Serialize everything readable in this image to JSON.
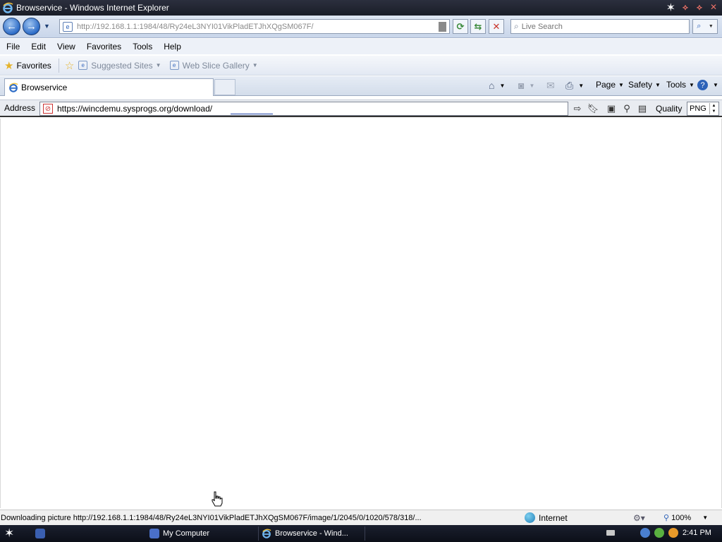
{
  "window": {
    "title": "Browservice - Windows Internet Explorer"
  },
  "navbar": {
    "url": "http://192.168.1.1:1984/48/Ry24eL3NYI01VikPladETJhXQgSM067F/",
    "search_placeholder": "Live Search"
  },
  "menu": [
    "File",
    "Edit",
    "View",
    "Favorites",
    "Tools",
    "Help"
  ],
  "favorites_bar": {
    "favorites_label": "Favorites",
    "links": [
      {
        "label": "Suggested Sites"
      },
      {
        "label": "Web Slice Gallery"
      }
    ]
  },
  "tabs": {
    "active": "Browservice"
  },
  "command_bar": {
    "page": "Page",
    "safety": "Safety",
    "tools": "Tools"
  },
  "address_bar": {
    "label": "Address",
    "value": "https://wincdemu.sysprogs.org/download/",
    "quality_label": "Quality",
    "quality_value": "PNG"
  },
  "status": {
    "text": "Downloading picture http://192.168.1.1:1984/48/Ry24eL3NYI01VikPladETJhXQgSM067F/image/1/2045/0/1020/578/318/...",
    "zone": "Internet",
    "zoom": "100%"
  },
  "taskbar": {
    "apps": [
      {
        "label": "Browservice - Wind...",
        "active": true
      },
      {
        "label": "My Computer",
        "active": false
      }
    ],
    "clock": "2:41 PM"
  },
  "colors": {
    "titlebar": "#1a1d28",
    "accent": "#2d6cc7",
    "taskbar": "#0c0f18"
  }
}
